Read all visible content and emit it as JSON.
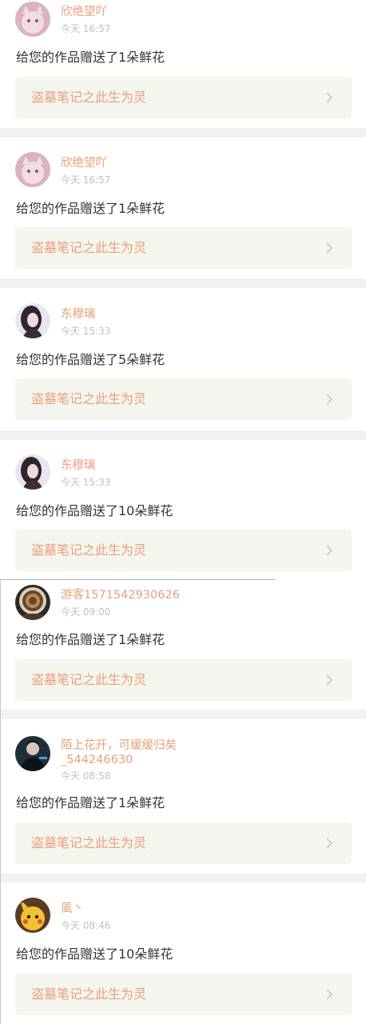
{
  "items": [
    {
      "user": "欣绝望吖",
      "time": "今天 16:57",
      "message": "给您的作品赠送了1朵鲜花",
      "work": "盗墓笔记之此生为灵",
      "avatar_icon": "pink-cat-avatar-icon"
    },
    {
      "user": "欣绝望吖",
      "time": "今天 16:57",
      "message": "给您的作品赠送了1朵鲜花",
      "work": "盗墓笔记之此生为灵",
      "avatar_icon": "pink-cat-avatar-icon"
    },
    {
      "user": "东穆璃",
      "time": "今天 15:33",
      "message": "给您的作品赠送了5朵鲜花",
      "work": "盗墓笔记之此生为灵",
      "avatar_icon": "girl-portrait-avatar-icon"
    },
    {
      "user": "东穆璃",
      "time": "今天 15:33",
      "message": "给您的作品赠送了10朵鲜花",
      "work": "盗墓笔记之此生为灵",
      "avatar_icon": "girl-portrait-avatar-icon"
    },
    {
      "user": "游客1571542930626",
      "time": "今天 09:00",
      "message": "给您的作品赠送了1朵鲜花",
      "work": "盗墓笔记之此生为灵",
      "avatar_icon": "coffee-cup-avatar-icon"
    },
    {
      "user": "陌上花开，可缓缓归矣",
      "user_line2": "_544246630",
      "time": "今天 08:58",
      "message": "给您的作品赠送了1朵鲜花",
      "work": "盗墓笔记之此生为灵",
      "avatar_icon": "dark-figure-avatar-icon"
    },
    {
      "user": "風丶",
      "time": "今天 08:46",
      "message": "给您的作品赠送了10朵鲜花",
      "work": "盗墓笔记之此生为灵",
      "avatar_icon": "pikachu-avatar-icon"
    }
  ],
  "colors": {
    "username": "#e7a07a",
    "time": "#c0c0c0",
    "message": "#333333",
    "work_title": "#e8a07a",
    "work_bg": "#f5f5ef",
    "separator": "#f2f2f2"
  }
}
